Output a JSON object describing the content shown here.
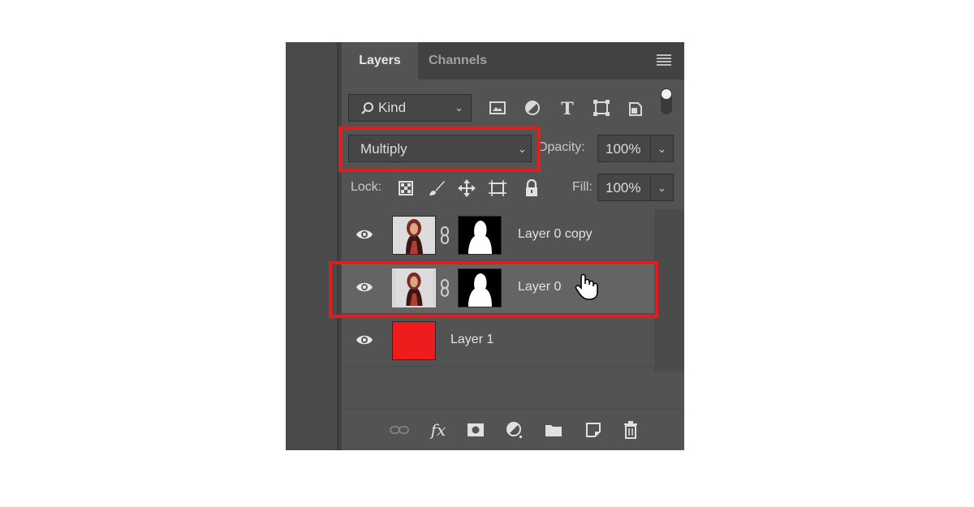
{
  "tabs": [
    {
      "label": "Layers",
      "active": true
    },
    {
      "label": "Channels",
      "active": false
    }
  ],
  "filter": {
    "kind_label": "Kind",
    "search_icon": "search-icon"
  },
  "filter_icons": [
    "image-filter-icon",
    "adjustment-filter-icon",
    "type-filter-icon",
    "shape-filter-icon",
    "smart-object-filter-icon",
    "filter-toggle-icon"
  ],
  "blend": {
    "mode": "Multiply",
    "opacity_label": "Opacity:",
    "opacity_value": "100%"
  },
  "lock": {
    "label": "Lock:",
    "icons": [
      "lock-transparent-pixels-icon",
      "lock-image-pixels-icon",
      "lock-position-icon",
      "lock-artboard-icon",
      "lock-all-icon"
    ],
    "fill_label": "Fill:",
    "fill_value": "100%"
  },
  "layers": [
    {
      "name": "Layer 0 copy",
      "visible": true,
      "selected": false,
      "has_mask": true,
      "thumb": "photo"
    },
    {
      "name": "Layer 0",
      "visible": true,
      "selected": true,
      "has_mask": true,
      "thumb": "photo"
    },
    {
      "name": "Layer 1",
      "visible": true,
      "selected": false,
      "has_mask": false,
      "thumb": "solid",
      "thumb_color": "#ee1c1c"
    }
  ],
  "bottom_icons": [
    "link-layers-icon",
    "fx-icon",
    "add-mask-icon",
    "adjustment-layer-icon",
    "new-group-icon",
    "new-layer-icon",
    "delete-icon"
  ],
  "colors": {
    "panel": "#535353",
    "selected_row": "#646464",
    "highlight": "#e01e1e",
    "layer1_fill": "#ee1c1c"
  }
}
